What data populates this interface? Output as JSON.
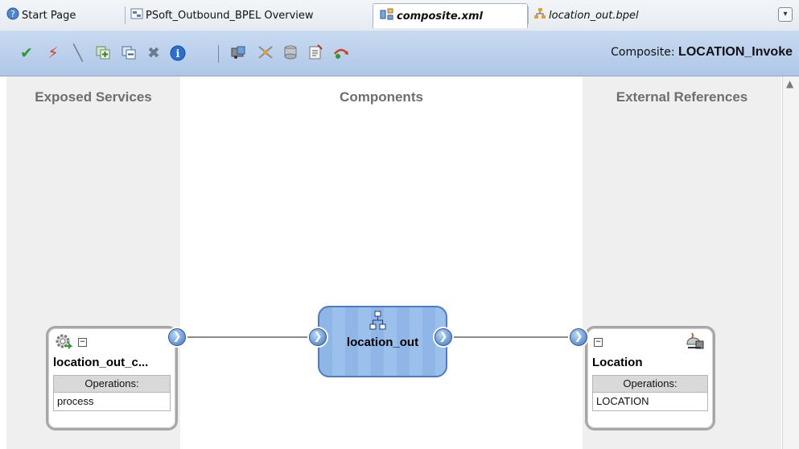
{
  "tabs": [
    {
      "label": "Start Page",
      "icon": "help-icon"
    },
    {
      "label": "PSoft_Outbound_BPEL Overview",
      "icon": "overview-icon"
    },
    {
      "label": "composite.xml",
      "icon": "composite-icon"
    },
    {
      "label": "location_out.bpel",
      "icon": "bpel-icon"
    }
  ],
  "toolbar": {
    "composite_prefix": "Composite:",
    "composite_name": "LOCATION_Invoke",
    "icons": [
      "validate-icon",
      "deploy-icon",
      "wire-icon",
      "add-service-icon",
      "add-reference-icon",
      "delete-icon",
      "info-icon",
      "adapter-icon",
      "mediator-icon",
      "rule-icon",
      "properties-icon",
      "test-icon"
    ]
  },
  "lanes": {
    "left": "Exposed Services",
    "middle": "Components",
    "right": "External References"
  },
  "service": {
    "name": "location_out_c...",
    "ops_label": "Operations:",
    "operation": "process"
  },
  "component": {
    "name": "location_out"
  },
  "reference": {
    "name": "Location",
    "ops_label": "Operations:",
    "operation": "LOCATION"
  },
  "colors": {
    "toolbar": "#b8cfec",
    "lane": "#efefef",
    "component_fill": "#8fb6e6",
    "component_border": "#4c7cc4"
  }
}
